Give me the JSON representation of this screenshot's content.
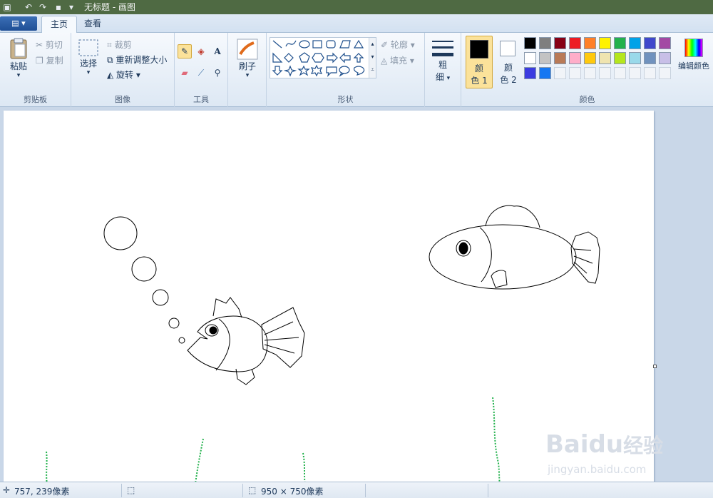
{
  "window": {
    "title": "无标题 - 画图"
  },
  "tabs": [
    "主页",
    "查看"
  ],
  "ribbon": {
    "clipboard": {
      "group_label": "剪贴板",
      "paste": "粘贴",
      "cut": "剪切",
      "copy": "复制"
    },
    "image": {
      "group_label": "图像",
      "select": "选择",
      "crop": "裁剪",
      "resize": "重新调整大小",
      "rotate": "旋转"
    },
    "tools": {
      "group_label": "工具"
    },
    "brushes": {
      "label": "刷子"
    },
    "shapes": {
      "group_label": "形状",
      "outline": "轮廓",
      "fill": "填充"
    },
    "size": {
      "label_1": "粗",
      "label_2": "细"
    },
    "colors": {
      "group_label": "颜色",
      "color1_1": "颜",
      "color1_2": "色 1",
      "color2_1": "颜",
      "color2_2": "色 2",
      "edit": "编辑颜色",
      "color1_value": "#000000",
      "color2_value": "#ffffff",
      "palette_row1": [
        "#000000",
        "#7f7f7f",
        "#880015",
        "#ed1c24",
        "#ff7f27",
        "#fff200",
        "#22b14c",
        "#00a2e8",
        "#3f48cc",
        "#a349a4"
      ],
      "palette_row2": [
        "#ffffff",
        "#c3c3c3",
        "#b97a57",
        "#ffaec9",
        "#ffc90e",
        "#efe4b0",
        "#b5e61d",
        "#99d9ea",
        "#7092be",
        "#c8bfe7"
      ],
      "palette_row3": [
        "#3b3be0",
        "#1577f2"
      ]
    }
  },
  "status": {
    "cursor": "757, 239像素",
    "size": "950 × 750像素"
  },
  "watermark": {
    "brand": "Baidu",
    "brand2": "经验",
    "url": "jingyan.baidu.com"
  }
}
